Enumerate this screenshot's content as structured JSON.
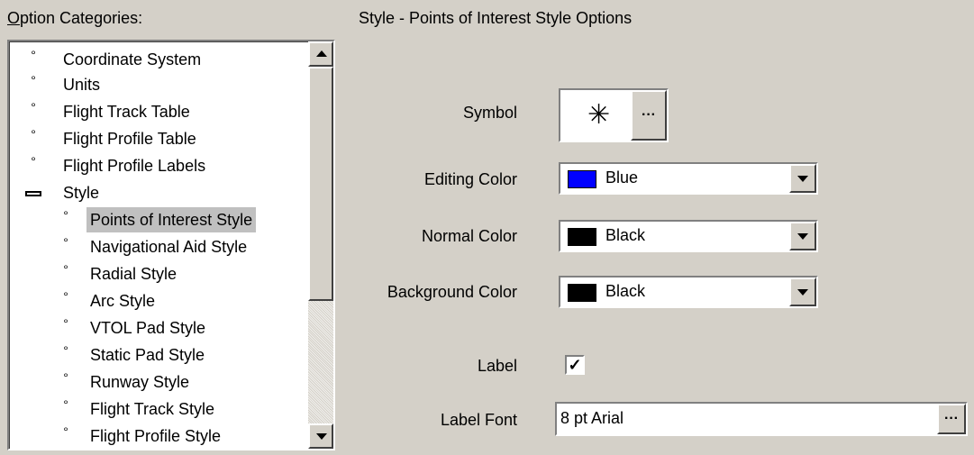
{
  "categories": {
    "title_accel": "O",
    "title_rest": "ption Categories:",
    "items": [
      {
        "label": "Coordinate System"
      },
      {
        "label": "Units"
      },
      {
        "label": "Flight Track Table"
      },
      {
        "label": "Flight Profile Table"
      },
      {
        "label": "Flight Profile Labels"
      },
      {
        "label": "Style"
      },
      {
        "label": "Points of Interest Style"
      },
      {
        "label": "Navigational Aid Style"
      },
      {
        "label": "Radial Style"
      },
      {
        "label": "Arc Style"
      },
      {
        "label": "VTOL Pad Style"
      },
      {
        "label": "Static Pad Style"
      },
      {
        "label": "Runway Style"
      },
      {
        "label": "Flight Track Style"
      },
      {
        "label": "Flight Profile Style"
      }
    ]
  },
  "panel": {
    "title": "Style - Points of Interest Style Options",
    "symbol_label": "Symbol",
    "symbol_glyph": "✳",
    "symbol_button": "···",
    "editing_color_label": "Editing Color",
    "editing_color_value": "Blue",
    "normal_color_label": "Normal Color",
    "normal_color_value": "Black",
    "background_color_label": "Background Color",
    "background_color_value": "Black",
    "label_label": "Label",
    "label_checked": "✓",
    "label_font_label": "Label Font",
    "label_font_value": "8 pt Arial",
    "label_font_button": "···"
  },
  "colors": {
    "blue": "#0000ff",
    "black": "#000000",
    "selected_bg": "#c0c0c0"
  }
}
